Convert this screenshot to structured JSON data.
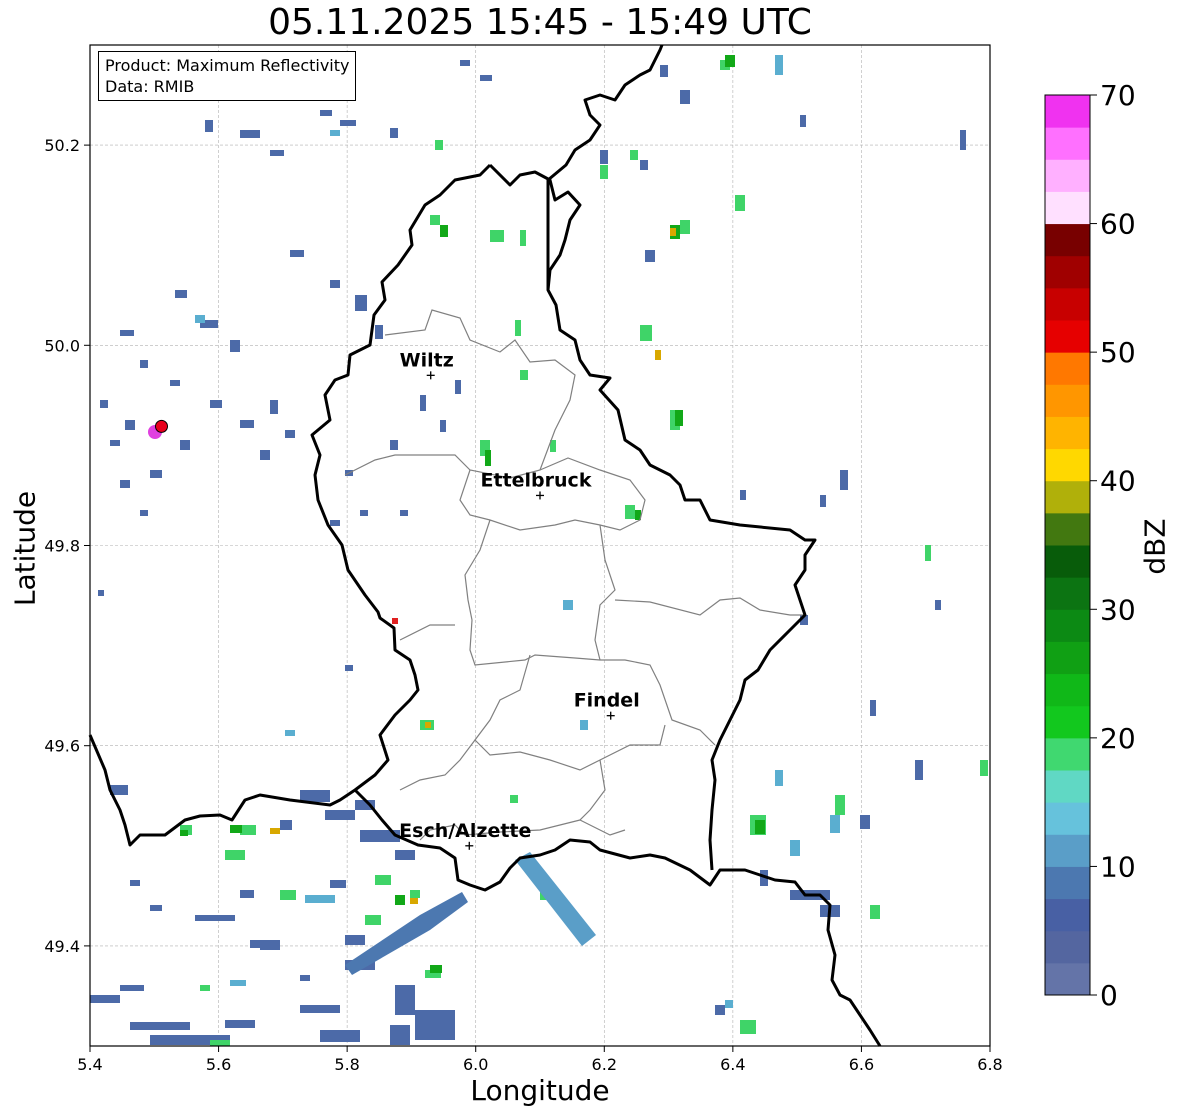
{
  "title": "05.11.2025 15:45 - 15:49 UTC",
  "info": {
    "product": "Product: Maximum Reflectivity",
    "data": "Data: RMIB"
  },
  "axes": {
    "xlabel": "Longitude",
    "ylabel": "Latitude",
    "xlim": [
      5.4,
      6.8
    ],
    "ylim": [
      49.3,
      50.3
    ],
    "xticks": [
      "5.4",
      "5.6",
      "5.8",
      "6.0",
      "6.2",
      "6.4",
      "6.6",
      "6.8"
    ],
    "yticks": [
      "49.4",
      "49.6",
      "49.8",
      "50.0",
      "50.2"
    ],
    "grid": true
  },
  "colorbar": {
    "label": "dBZ",
    "ticks": [
      "0",
      "10",
      "20",
      "30",
      "40",
      "50",
      "60",
      "70"
    ],
    "colors": [
      "#6474a8",
      "#5466a0",
      "#4860a4",
      "#4c78b0",
      "#5a9ec8",
      "#66c2dc",
      "#60d8c4",
      "#40d870",
      "#12c81e",
      "#10b818",
      "#10a014",
      "#0c8a14",
      "#0c7412",
      "#085c0a",
      "#427810",
      "#b0b00a",
      "#ffd800",
      "#ffb400",
      "#ff9600",
      "#ff7800",
      "#e60000",
      "#c80000",
      "#a00000",
      "#780000",
      "#ffe0ff",
      "#ffb0ff",
      "#ff70ff",
      "#f032f0"
    ]
  },
  "cities": [
    {
      "name": "Wiltz",
      "lon": 5.93,
      "lat": 49.97
    },
    {
      "name": "Ettelbruck",
      "lon": 6.1,
      "lat": 49.85
    },
    {
      "name": "Findel",
      "lon": 6.21,
      "lat": 49.63
    },
    {
      "name": "Esch/Alzette",
      "lon": 5.99,
      "lat": 49.5
    }
  ],
  "radar_site": {
    "lon": 5.505,
    "lat": 49.915,
    "color": "#e8001c"
  }
}
